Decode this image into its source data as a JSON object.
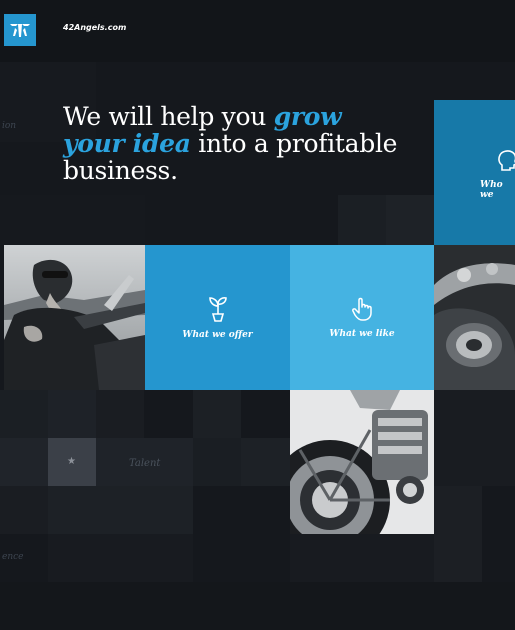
{
  "header": {
    "site_name": "42Angels.com"
  },
  "hero": {
    "line1_prefix": "We will help you ",
    "line1_accent": "grow",
    "line2_accent": "your idea",
    "line2_rest": " into a profitable",
    "line3": "business."
  },
  "side_words": {
    "left_top": "ion",
    "left_bottom": "ence"
  },
  "tiles": {
    "what_we_offer": "What we offer",
    "what_we_like": "What we like",
    "who_we": "Who we"
  },
  "grid": {
    "talent_label": "Talent",
    "star_glyph": "★"
  },
  "icons": {
    "logo": "angel-wings-logo-icon",
    "offer": "plant-sprout-icon",
    "like": "pointing-hand-icon",
    "who": "head-profile-icon"
  },
  "colors": {
    "brand_blue": "#2596cf",
    "light_blue": "#45b3e2",
    "dark_blue": "#1779a8",
    "accent_text": "#2ba3de",
    "background": "#15181d"
  }
}
